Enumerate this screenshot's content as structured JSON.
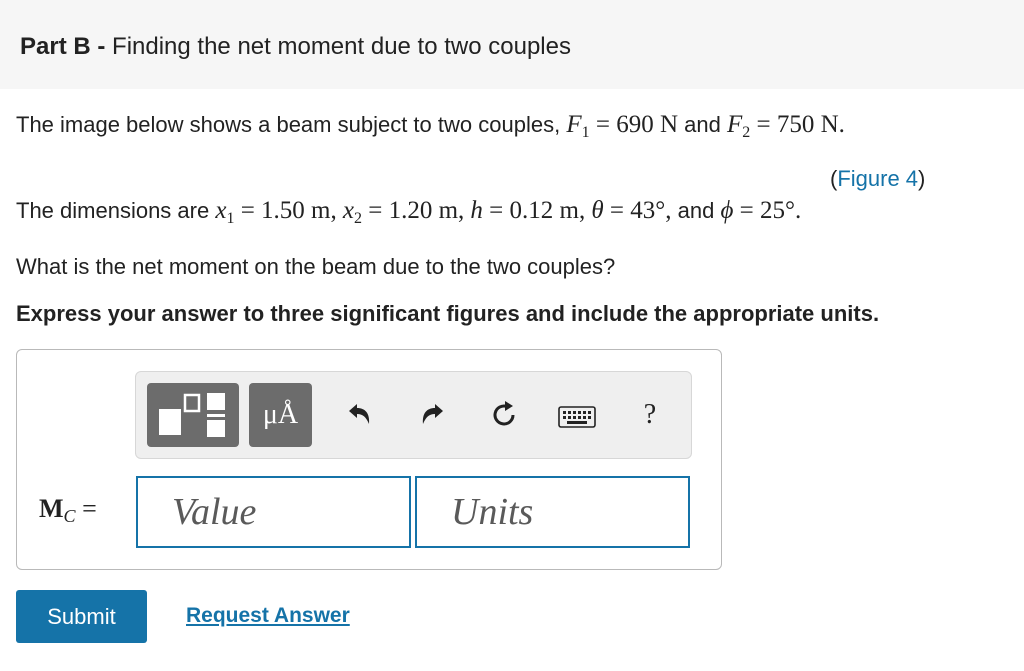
{
  "header": {
    "part_label": "Part B -",
    "part_title": "Finding the net moment due to two couples"
  },
  "problem": {
    "line1_text": "The image below shows a beam subject to two couples,",
    "F1": "= 690 N",
    "and1": "and",
    "F2": "= 750 N.",
    "figure_link": "Figure 4",
    "line2_text": "The dimensions are",
    "x1": "= 1.50 m,",
    "x2": "= 1.20 m,",
    "h": "= 0.12 m,",
    "theta": "= 43°,",
    "and2": "and",
    "phi": "= 25°.",
    "question": "What is the net moment on the beam due to the two couples?",
    "instruction": "Express your answer to three significant figures and include the appropriate units."
  },
  "toolbar": {
    "units_label": "μÅ",
    "help_label": "?",
    "icons": [
      "templates-icon",
      "units-icon",
      "undo-icon",
      "redo-icon",
      "reset-icon",
      "keyboard-icon",
      "help-icon"
    ]
  },
  "answer": {
    "label_main": "M",
    "label_sub": "C",
    "label_eq": "=",
    "value_placeholder": "Value",
    "units_placeholder": "Units"
  },
  "actions": {
    "submit_label": "Submit",
    "request_label": "Request Answer"
  },
  "colors": {
    "accent": "#1573a8",
    "header_bg": "#f6f6f6",
    "button_gray": "#6c6c6c"
  }
}
